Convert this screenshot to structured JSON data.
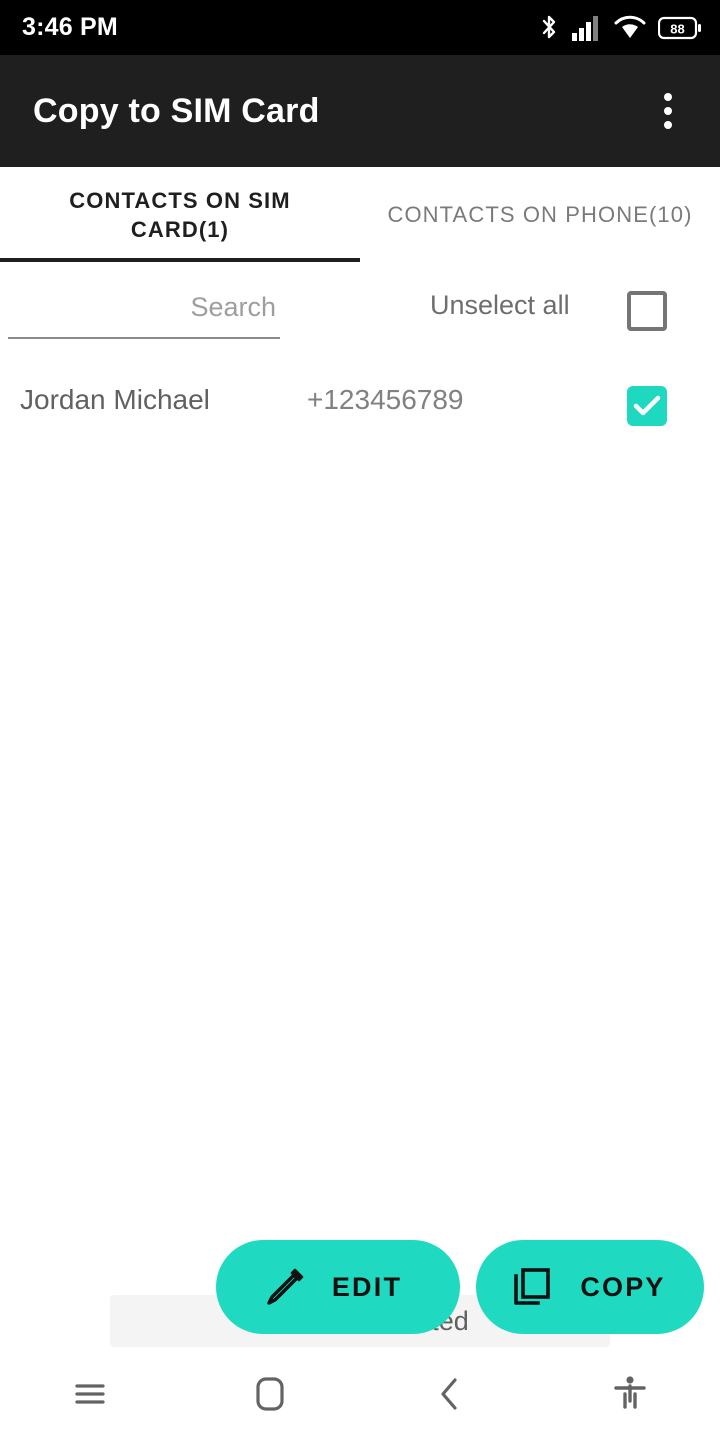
{
  "status_bar": {
    "clock": "3:46 PM",
    "battery_level": "88",
    "icons": [
      "bluetooth-icon",
      "cellular-signal-icon",
      "wifi-icon",
      "battery-icon"
    ]
  },
  "app_bar": {
    "title": "Copy to SIM Card",
    "overflow_menu": "overflow-menu-icon"
  },
  "tabs": [
    {
      "label": "CONTACTS ON SIM CARD(1)",
      "active": true
    },
    {
      "label": "CONTACTS ON PHONE(10)",
      "active": false
    }
  ],
  "controls": {
    "search_placeholder": "Search",
    "search_value": "",
    "select_all_label": "Unselect all",
    "select_all_checked": false
  },
  "contacts": [
    {
      "name": "Jordan Michael",
      "phone": "+123456789",
      "selected": true
    }
  ],
  "snackbar": {
    "text": "1 contact selected"
  },
  "actions": [
    {
      "label": "EDIT",
      "icon": "pencil-icon"
    },
    {
      "label": "COPY",
      "icon": "copy-icon"
    }
  ],
  "nav_bar": {
    "items": [
      "menu-icon",
      "home-icon",
      "back-icon",
      "accessibility-icon"
    ]
  },
  "colors": {
    "accent": "#1fd9c0",
    "app_bar": "#1f1f1f",
    "status_bar": "#000000",
    "text_primary": "#1f1f1f",
    "text_secondary": "#757575"
  }
}
